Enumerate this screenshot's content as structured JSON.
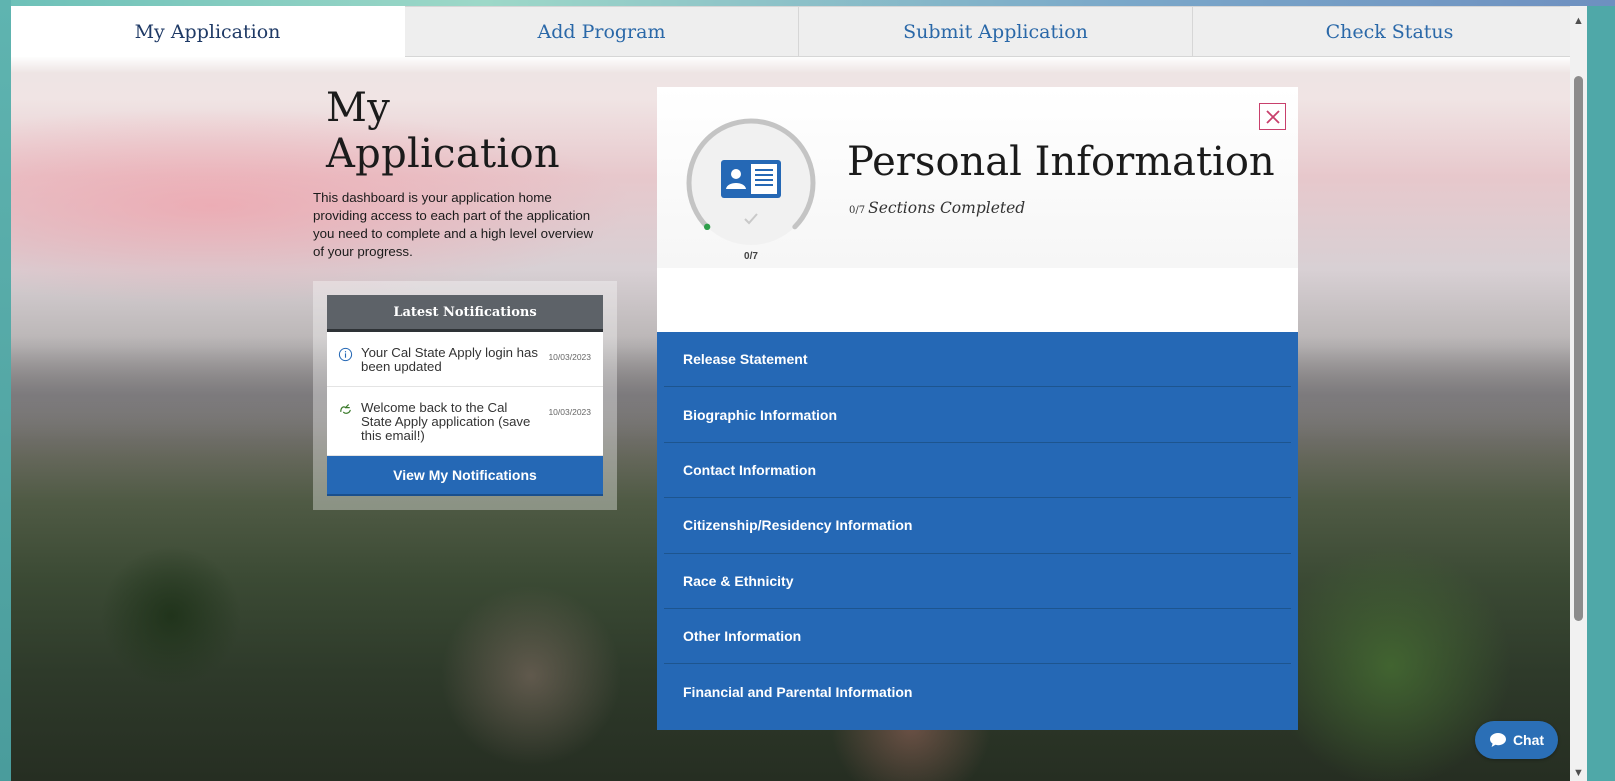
{
  "tabs": [
    {
      "label": "My Application",
      "active": true
    },
    {
      "label": "Add Program",
      "active": false
    },
    {
      "label": "Submit Application",
      "active": false
    },
    {
      "label": "Check Status",
      "active": false
    }
  ],
  "page": {
    "title": "My Application",
    "description": "This dashboard is your application home providing access to each part of the application you need to complete and a high level overview of your progress."
  },
  "notifications": {
    "header": "Latest Notifications",
    "items": [
      {
        "icon": "info-icon",
        "text": "Your Cal State Apply login has been updated",
        "date": "10/03/2023"
      },
      {
        "icon": "wave-hand-icon",
        "text": "Welcome back to the Cal State Apply application (save this email!)",
        "date": "10/03/2023"
      }
    ],
    "button_label": "View My Notifications"
  },
  "panel": {
    "title": "Personal Information",
    "progress_fraction": "0/7",
    "subtitle": "Sections Completed",
    "gauge_label": "0/7",
    "completed": 0,
    "total": 7,
    "icon": "id-card-icon",
    "close_icon": "close-icon",
    "sections": [
      "Release Statement",
      "Biographic Information",
      "Contact Information",
      "Citizenship/Residency Information",
      "Race & Ethnicity",
      "Other Information",
      "Financial and Parental Information"
    ]
  },
  "chat": {
    "label": "Chat"
  },
  "colors": {
    "brand_blue": "#2568b5",
    "tab_text": "#2a68a8",
    "notif_header": "#5d6268",
    "close_accent": "#c8406c",
    "gauge_dot": "#2e9e4a"
  }
}
